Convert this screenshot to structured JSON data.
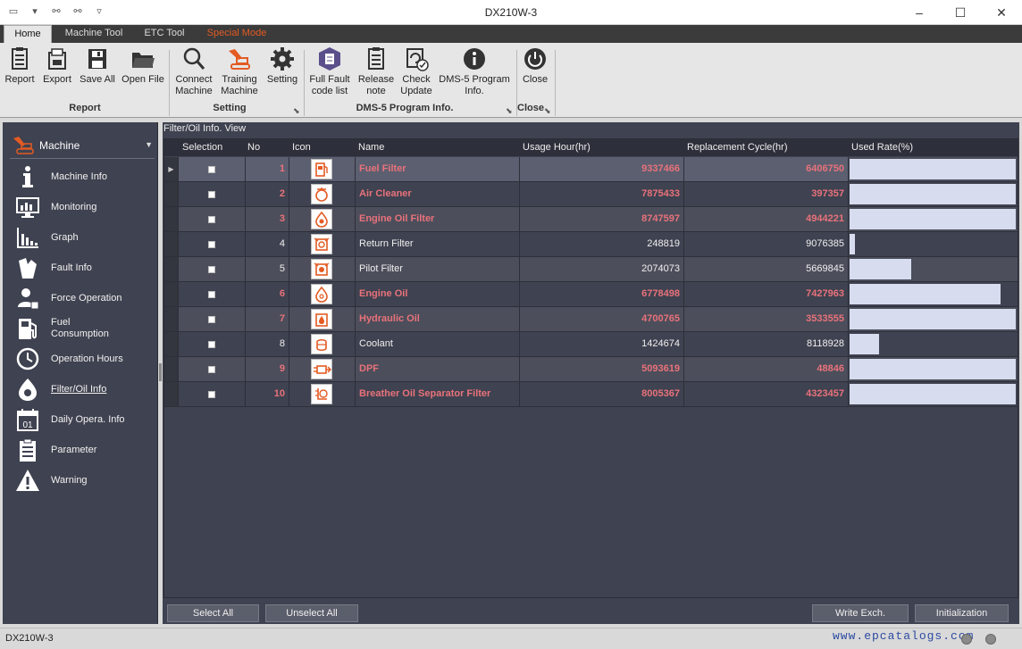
{
  "window": {
    "title": "DX210W-3"
  },
  "quick_access": {
    "icons": [
      "monitor-icon",
      "link-icon",
      "unlink-icon",
      "dropdown-icon"
    ]
  },
  "tabs": [
    {
      "label": "Home",
      "active": true
    },
    {
      "label": "Machine Tool"
    },
    {
      "label": "ETC Tool"
    },
    {
      "label": "Special Mode",
      "color": "#e35b23"
    }
  ],
  "ribbon": {
    "groups": [
      {
        "label": "Report"
      },
      {
        "label": "Setting"
      },
      {
        "label": "DMS-5 Program Info."
      },
      {
        "label": "Close"
      }
    ],
    "buttons": {
      "report": "Report",
      "export": "Export",
      "save_all": "Save All",
      "open_file": "Open File",
      "connect_l1": "Connect",
      "connect_l2": "Machine",
      "training_l1": "Training",
      "training_l2": "Machine",
      "setting": "Setting",
      "fullfault_l1": "Full Fault",
      "fullfault_l2": "code list",
      "release_l1": "Release",
      "release_l2": "note",
      "check_l1": "Check",
      "check_l2": "Update",
      "dms_l1": "DMS-5 Program",
      "dms_l2": "Info.",
      "close": "Close"
    }
  },
  "sidebar": {
    "header": "Machine",
    "items": [
      {
        "label": "Machine Info",
        "icon": "info-icon"
      },
      {
        "label": "Monitoring",
        "icon": "monitor-icon"
      },
      {
        "label": "Graph",
        "icon": "graph-icon"
      },
      {
        "label": "Fault Info",
        "icon": "fault-icon"
      },
      {
        "label": "Force Operation",
        "icon": "force-operation-icon"
      },
      {
        "label_l1": "Fuel",
        "label_l2": "Consumption",
        "icon": "fuel-icon"
      },
      {
        "label": "Operation Hours",
        "icon": "clock-icon"
      },
      {
        "label": "Filter/Oil Info",
        "icon": "oil-drop-icon",
        "active": true
      },
      {
        "label": "Daily Opera. Info",
        "icon": "calendar-icon",
        "calendar_text": "01"
      },
      {
        "label": "Parameter",
        "icon": "clipboard-icon"
      },
      {
        "label": "Warning",
        "icon": "warning-icon"
      }
    ]
  },
  "main": {
    "title": "Filter/Oil Info. View",
    "columns": [
      "Selection",
      "No",
      "Icon",
      "Name",
      "Usage Hour(hr)",
      "Replacement Cycle(hr)",
      "Used Rate(%)"
    ],
    "rows": [
      {
        "no": "1",
        "name": "Fuel Filter",
        "usage": "9337466",
        "cycle": "6406750",
        "rate": 100,
        "over": true,
        "icon": "fuel-filter-icon",
        "selected": true
      },
      {
        "no": "2",
        "name": "Air Cleaner",
        "usage": "7875433",
        "cycle": "397357",
        "rate": 100,
        "over": true,
        "icon": "air-cleaner-icon"
      },
      {
        "no": "3",
        "name": "Engine Oil Filter",
        "usage": "8747597",
        "cycle": "4944221",
        "rate": 100,
        "over": true,
        "icon": "engine-oil-filter-icon"
      },
      {
        "no": "4",
        "name": "Return Filter",
        "usage": "248819",
        "cycle": "9076385",
        "rate": 3,
        "over": false,
        "icon": "return-filter-icon"
      },
      {
        "no": "5",
        "name": "Pilot Filter",
        "usage": "2074073",
        "cycle": "5669845",
        "rate": 37,
        "over": false,
        "icon": "pilot-filter-icon"
      },
      {
        "no": "6",
        "name": "Engine Oil",
        "usage": "6778498",
        "cycle": "7427963",
        "rate": 91,
        "over": true,
        "icon": "engine-oil-icon"
      },
      {
        "no": "7",
        "name": "Hydraulic Oil",
        "usage": "4700765",
        "cycle": "3533555",
        "rate": 100,
        "over": true,
        "icon": "hydraulic-oil-icon"
      },
      {
        "no": "8",
        "name": "Coolant",
        "usage": "1424674",
        "cycle": "8118928",
        "rate": 18,
        "over": false,
        "icon": "coolant-icon"
      },
      {
        "no": "9",
        "name": "DPF",
        "usage": "5093619",
        "cycle": "48846",
        "rate": 100,
        "over": true,
        "icon": "dpf-icon"
      },
      {
        "no": "10",
        "name": "Breather Oil Separator Filter",
        "usage": "8005367",
        "cycle": "4323457",
        "rate": 100,
        "over": true,
        "icon": "breather-oil-separator-icon"
      }
    ],
    "buttons": {
      "select_all": "Select All",
      "unselect_all": "Unselect All",
      "write_exch": "Write Exch.",
      "initialization": "Initialization"
    }
  },
  "status": {
    "text": "DX210W-3",
    "watermark": "www.epcatalogs.com"
  },
  "colors": {
    "accent": "#e35b23",
    "over_text": "#e8727b",
    "bar": "#d7dcef",
    "panel": "#3f4250"
  }
}
